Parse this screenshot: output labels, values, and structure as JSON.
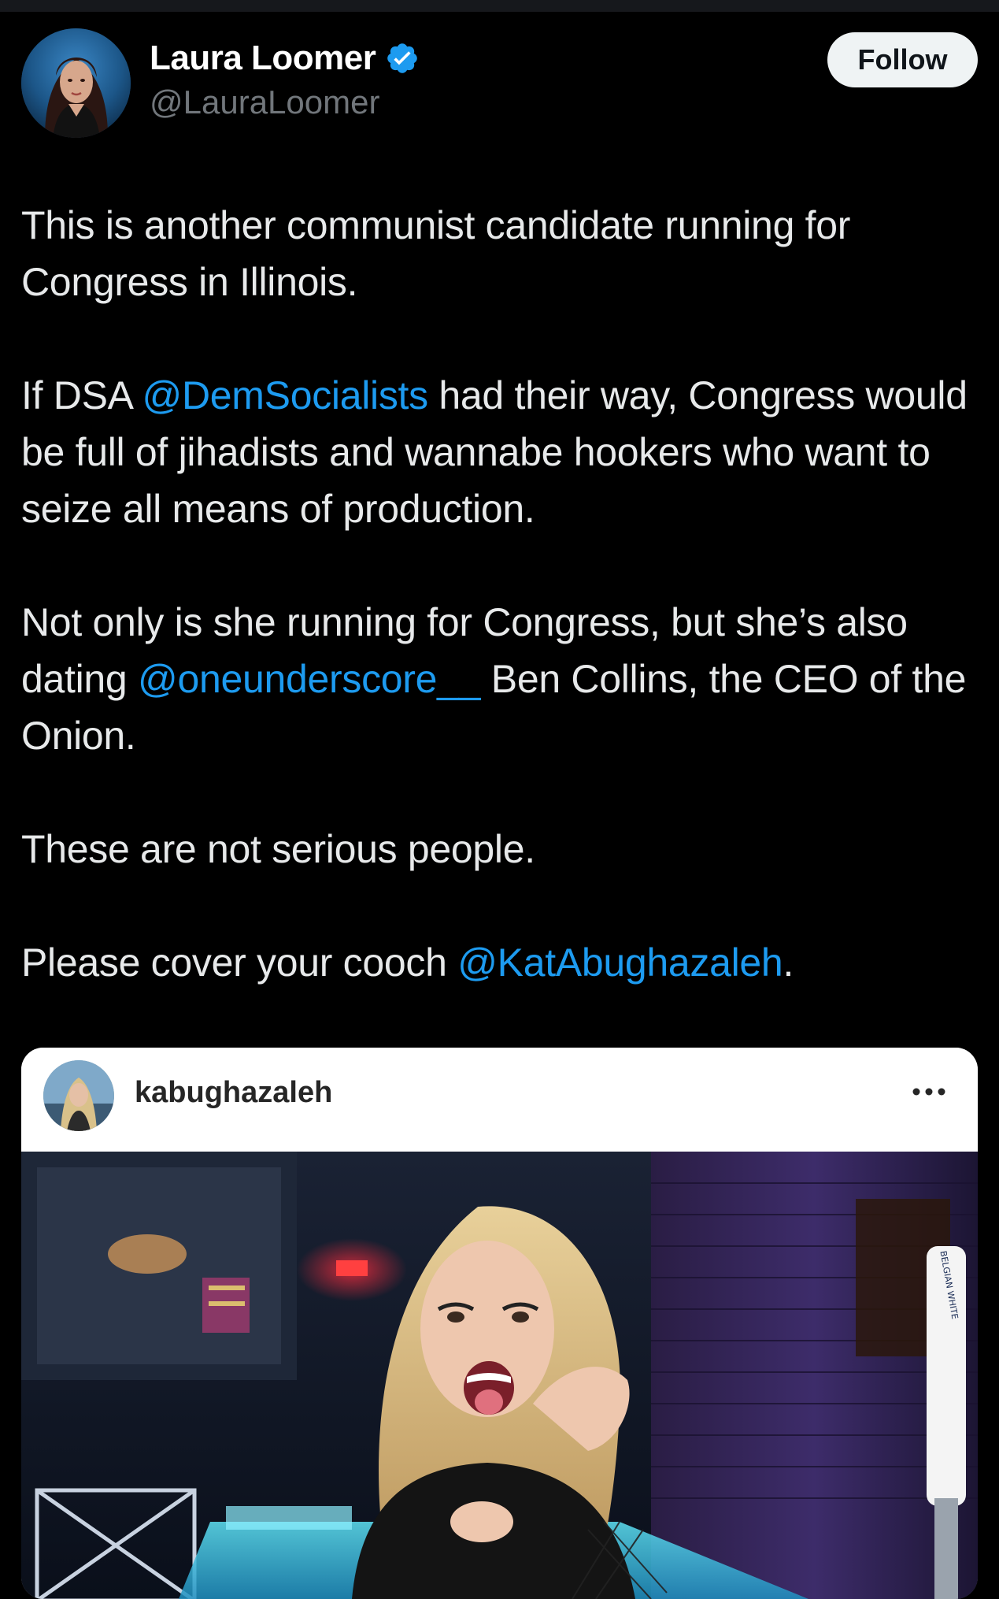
{
  "author": {
    "display_name": "Laura Loomer",
    "handle": "@LauraLoomer",
    "verified": true
  },
  "follow_button": {
    "label": "Follow"
  },
  "tweet": {
    "paragraphs": [
      {
        "segments": [
          {
            "text": "This is another communist candidate running for Congress in Illinois.",
            "mention": false
          }
        ]
      },
      {
        "segments": [
          {
            "text": "If DSA ",
            "mention": false
          },
          {
            "text": "@DemSocialists",
            "mention": true
          },
          {
            "text": " had their way, Congress would be full of jihadists and wannabe hookers who want to seize all means of production.",
            "mention": false
          }
        ]
      },
      {
        "segments": [
          {
            "text": "Not only is she running for Congress, but she’s also dating ",
            "mention": false
          },
          {
            "text": "@oneunderscore__",
            "mention": true
          },
          {
            "text": " Ben Collins, the CEO of the Onion.",
            "mention": false
          }
        ]
      },
      {
        "segments": [
          {
            "text": "These are not serious people.",
            "mention": false
          }
        ]
      },
      {
        "segments": [
          {
            "text": "Please cover your cooch ",
            "mention": false
          },
          {
            "text": "@KatAbughazaleh",
            "mention": true
          },
          {
            "text": ".",
            "mention": false
          }
        ]
      }
    ]
  },
  "embedded_post": {
    "username": "kabughazaleh",
    "more_icon": "more-horizontal-icon",
    "tap_text": "BELGIAN WHITE"
  },
  "colors": {
    "background": "#000000",
    "text": "#e7e9ea",
    "secondary_text": "#71767b",
    "link": "#1d9bf0",
    "verified_badge": "#1d9bf0",
    "follow_bg": "#eff3f4"
  }
}
